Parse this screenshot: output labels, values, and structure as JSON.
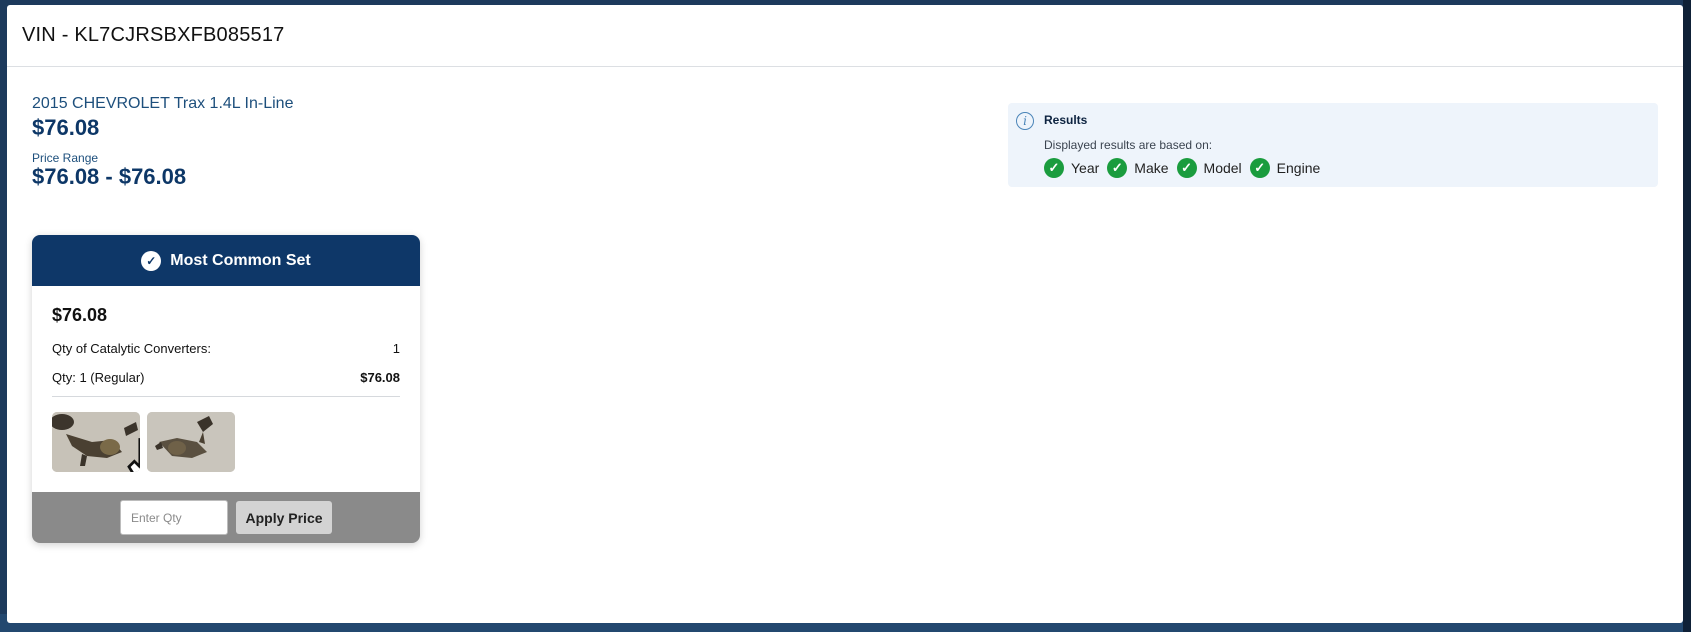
{
  "modal": {
    "title": "VIN - KL7CJRSBXFB085517"
  },
  "vehicle": {
    "title": "2015 CHEVROLET Trax 1.4L In-Line",
    "price": "$76.08",
    "price_range_label": "Price Range",
    "price_range": "$76.08 - $76.08"
  },
  "results": {
    "icon": "info-icon",
    "title": "Results",
    "subtitle": "Displayed results are based on:",
    "criteria": [
      {
        "label": "Year",
        "icon": "check-icon"
      },
      {
        "label": "Make",
        "icon": "check-icon"
      },
      {
        "label": "Model",
        "icon": "check-icon"
      },
      {
        "label": "Engine",
        "icon": "check-icon"
      }
    ]
  },
  "card": {
    "header": "Most Common Set",
    "header_icon": "check-circle-icon",
    "price": "$76.08",
    "qty_label": "Qty of Catalytic Converters:",
    "qty_value": "1",
    "line_label": "Qty: 1 (Regular)",
    "line_value": "$76.08",
    "images": [
      "catalytic-converter-photo-1",
      "catalytic-converter-photo-2"
    ],
    "qty_placeholder": "Enter Qty",
    "apply_label": "Apply Price"
  },
  "colors": {
    "navy": "#0e3768",
    "check_green": "#1a9c3e",
    "results_bg": "#eef4fb",
    "footer_gray": "#8a8a8a"
  }
}
